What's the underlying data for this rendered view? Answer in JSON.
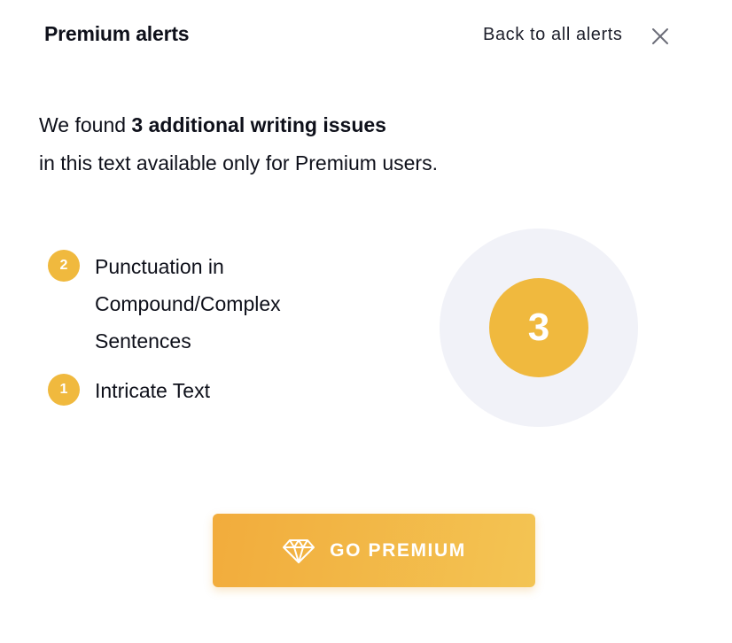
{
  "header": {
    "title": "Premium alerts",
    "back_link": "Back to all alerts",
    "close_icon": "close-icon"
  },
  "intro": {
    "prefix": "We found ",
    "highlight": "3 additional writing issues",
    "suffix": "in this text available only for Premium users."
  },
  "issues": [
    {
      "count": "2",
      "label": "Punctuation in Compound/Complex Sentences"
    },
    {
      "count": "1",
      "label": "Intricate Text"
    }
  ],
  "total": {
    "value": "3"
  },
  "cta": {
    "label": "GO PREMIUM",
    "icon": "diamond-icon"
  },
  "colors": {
    "accent": "#f0b93e",
    "circle_bg": "#f1f2f8",
    "button_gradient_start": "#f2ac3c",
    "button_gradient_end": "#f3c453"
  }
}
